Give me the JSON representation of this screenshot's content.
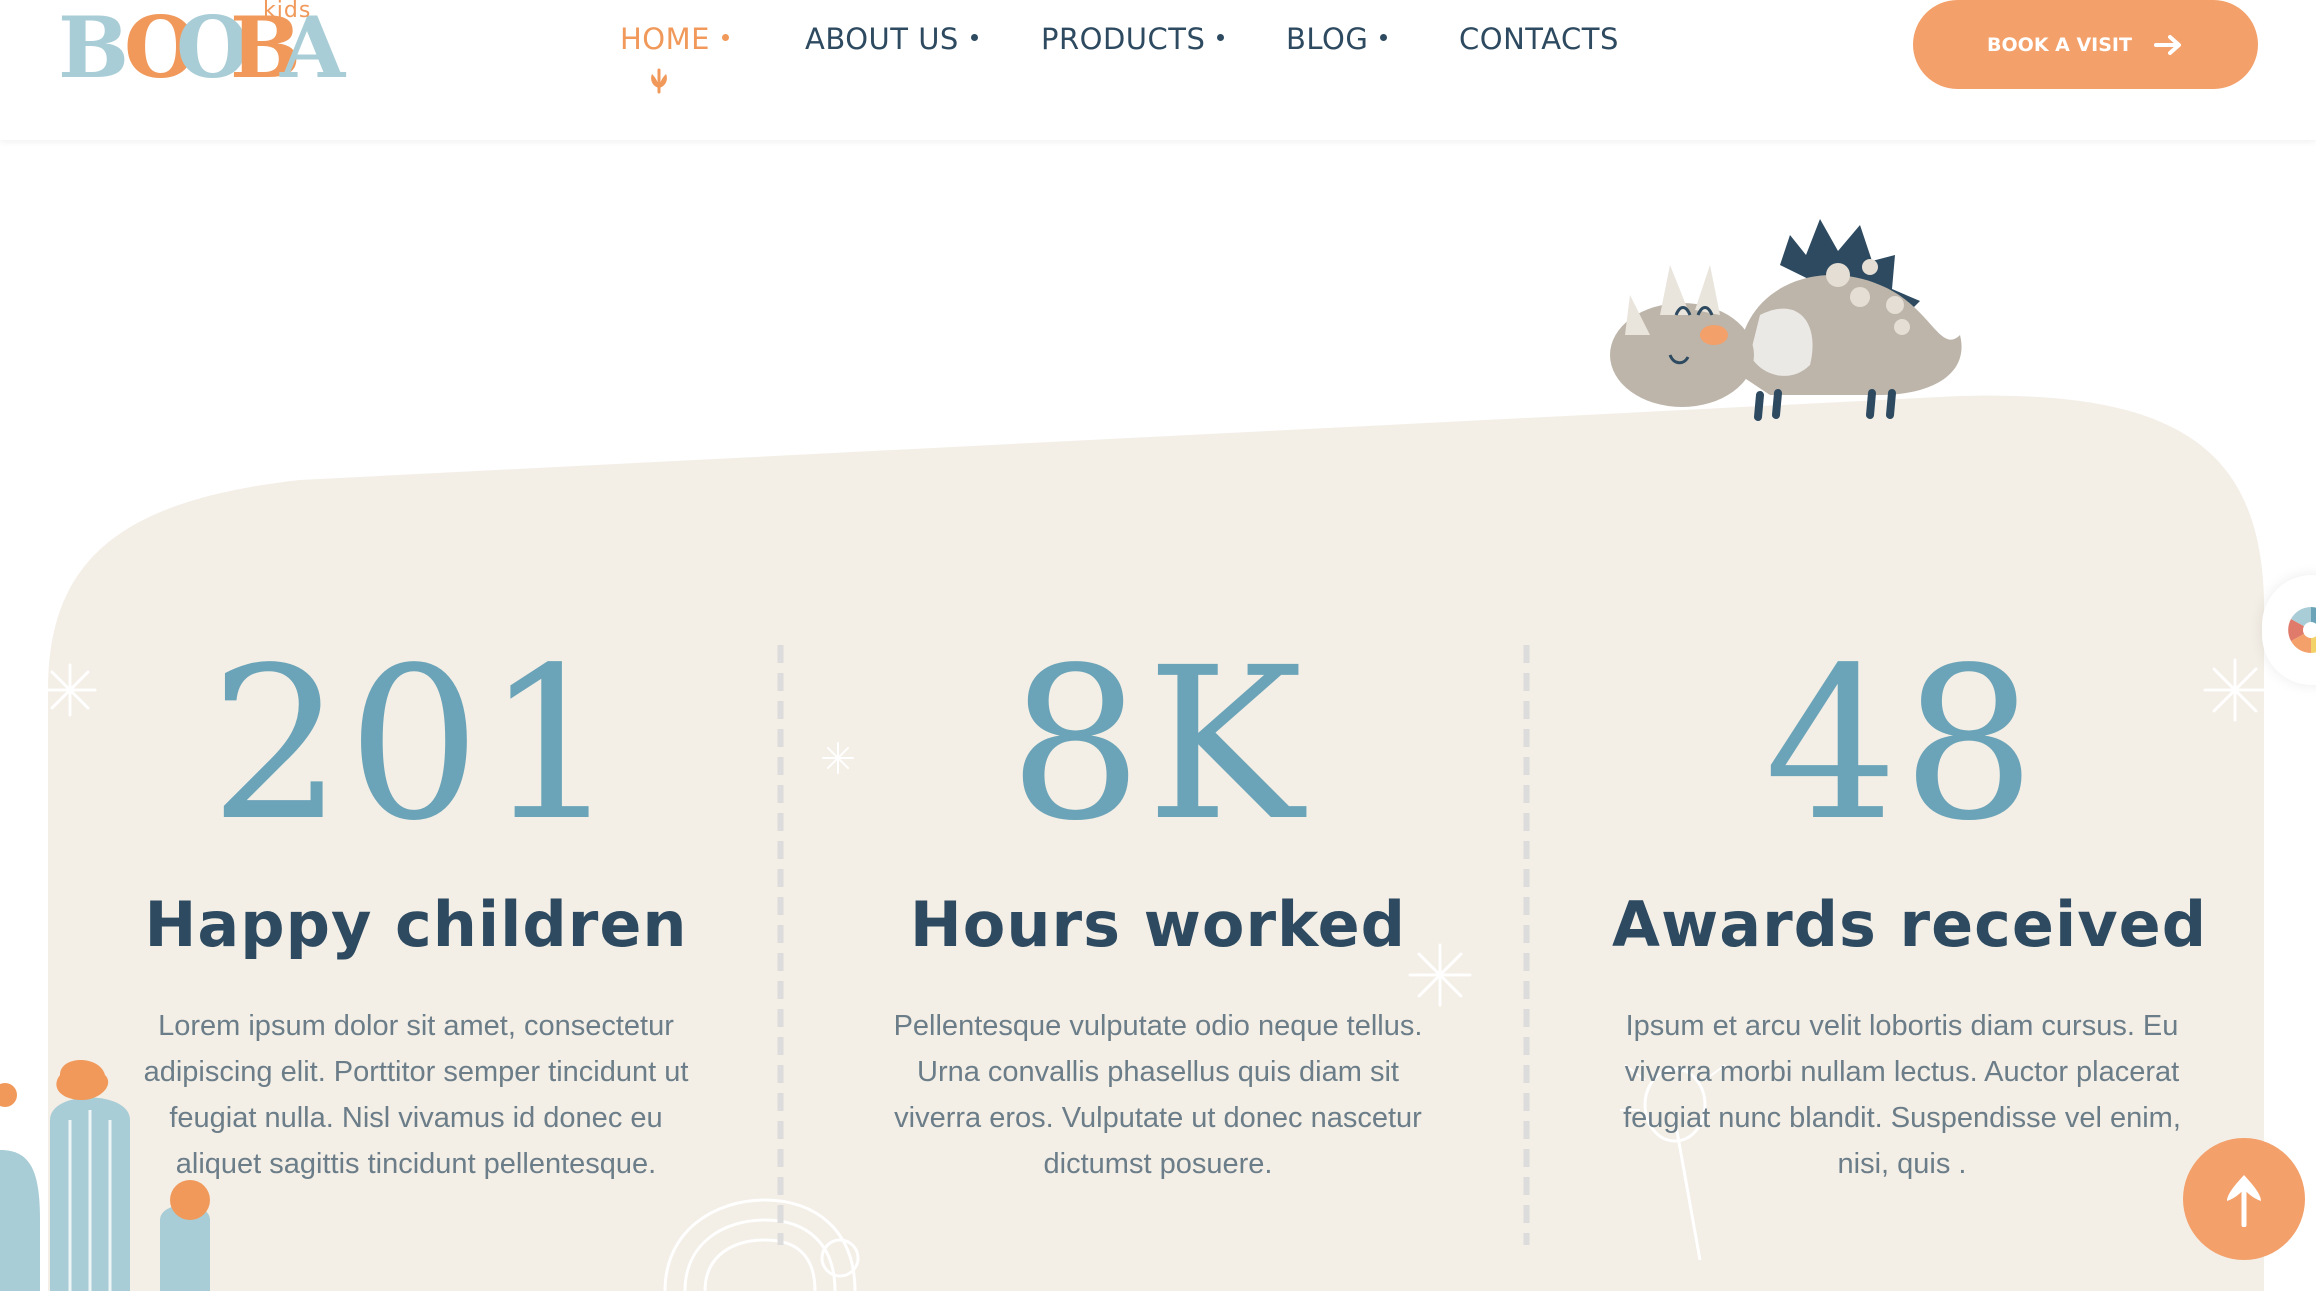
{
  "header": {
    "logo": {
      "letters": [
        "B",
        "O",
        "O",
        "B",
        "A"
      ],
      "small_text": "kids"
    },
    "nav": [
      {
        "label": "HOME",
        "active": true,
        "has_dot": true
      },
      {
        "label": "ABOUT US",
        "active": false,
        "has_dot": true
      },
      {
        "label": "PRODUCTS",
        "active": false,
        "has_dot": true
      },
      {
        "label": "BLOG",
        "active": false,
        "has_dot": true
      },
      {
        "label": "CONTACTS",
        "active": false,
        "has_dot": false
      }
    ],
    "cta_label": "BOOK A VISIT"
  },
  "stats": [
    {
      "number": "201",
      "label": "Happy children",
      "description": "Lorem ipsum dolor sit amet, consectetur adipiscing elit. Porttitor semper tincidunt ut feugiat nulla. Nisl vivamus id donec eu aliquet sagittis tincidunt pellentesque."
    },
    {
      "number": "8K",
      "label": "Hours worked",
      "description": "Pellentesque vulputate odio neque tellus. Urna convallis phasellus quis diam sit viverra eros. Vulputate ut donec nascetur dictumst posuere."
    },
    {
      "number": "48",
      "label": "Awards received",
      "description": "Ipsum et arcu velit lobortis diam cursus. Eu viverra morbi nullam lectus. Auctor placerat feugiat nunc blandit. Suspendisse vel enim, nisi, quis ."
    }
  ],
  "colors": {
    "accent_orange": "#f3a06a",
    "navy": "#2d4a60",
    "teal": "#6ba4b8",
    "section_bg": "#f3eee6",
    "body_text": "#6b7d88"
  },
  "icons": [
    "dinosaur-illustration",
    "cactus-illustration",
    "arrow-right-icon",
    "arrow-up-icon",
    "color-wheel-icon",
    "sparkle-icon",
    "rainbow-doodle",
    "dandelion-doodle"
  ]
}
